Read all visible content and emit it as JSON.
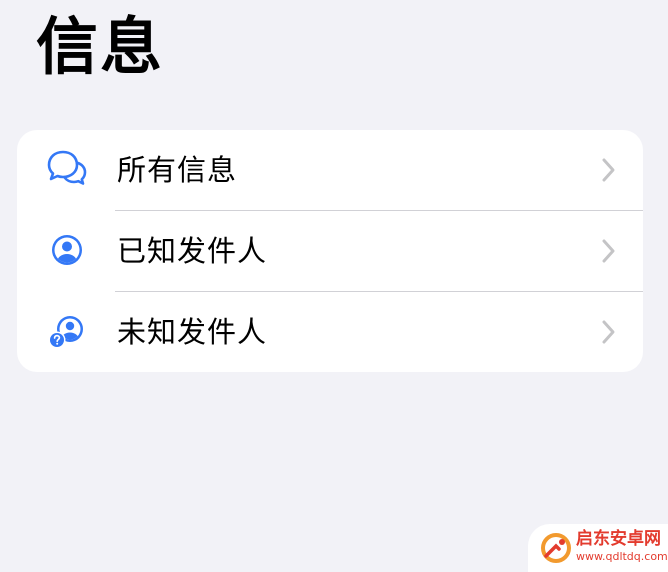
{
  "header": {
    "title": "信息"
  },
  "list": {
    "items": [
      {
        "label": "所有信息",
        "icon": "chat-bubbles-icon"
      },
      {
        "label": "已知发件人",
        "icon": "person-circle-icon"
      },
      {
        "label": "未知发件人",
        "icon": "person-question-icon"
      }
    ]
  },
  "watermark": {
    "name": "启东安卓网",
    "url": "www.qdltdq.com"
  },
  "colors": {
    "background": "#f2f2f7",
    "card": "#ffffff",
    "icon_accent": "#3478f6",
    "chevron": "#c4c4c6",
    "divider": "#d1d1d6",
    "watermark": "#e33b2e"
  }
}
